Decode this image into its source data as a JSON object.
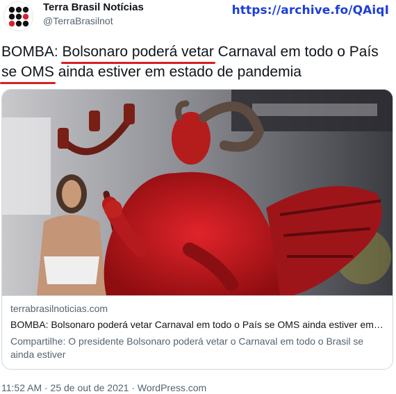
{
  "account": {
    "display_name": "Terra Brasil Notícias",
    "handle": "@TerraBrasilnot",
    "avatar_icon": "dot-grid-logo-icon"
  },
  "overlay": {
    "archive_link": "https://archive.fo/QAiqI",
    "underline_color": "#d81f1f"
  },
  "tweet": {
    "text_parts": [
      "BOMBA: ",
      "Bolsonaro poderá vetar",
      " Carnaval em todo o País ",
      "se OMS",
      " ainda estiver em estado de pandemia"
    ]
  },
  "card": {
    "image_icon": "carnival-devil-costume-photo",
    "domain": "terrabrasilnoticias.com",
    "title": "BOMBA: Bolsonaro poderá vetar Carnaval em todo o País se OMS ainda estiver em estado de pandemia",
    "description": "Compartilhe: O presidente Bolsonaro poderá vetar o Carnaval em todo o Brasil se ainda estiver"
  },
  "meta": {
    "timestamp": "11:52 AM · 25 de out de 2021 · WordPress.com"
  }
}
